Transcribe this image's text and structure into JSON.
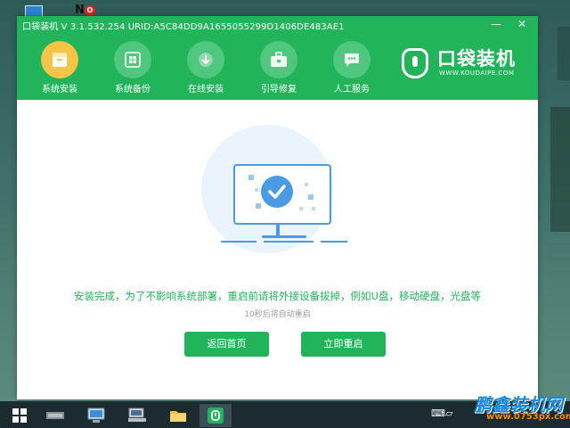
{
  "window": {
    "title": "口袋装机 V 3.1.532.254 URID:A5C84DD9A1655055299D1406DE483AE1",
    "minimize": "—",
    "close": "✕"
  },
  "nav": {
    "items": [
      {
        "label": "系统安装",
        "icon": "box-icon",
        "active": true
      },
      {
        "label": "系统备份",
        "icon": "windows-icon",
        "active": false
      },
      {
        "label": "在线安装",
        "icon": "download-icon",
        "active": false
      },
      {
        "label": "引导修复",
        "icon": "toolbox-icon",
        "active": false
      },
      {
        "label": "人工服务",
        "icon": "chat-icon",
        "active": false
      }
    ]
  },
  "brand": {
    "name": "口袋装机",
    "subtitle": "WWW.KOUDAIPE.COM"
  },
  "content": {
    "main_message": "安装完成，为了不影响系统部署，重启前请将外接设备拔掉，例如U盘，移动硬盘，光盘等",
    "countdown": "10秒后将自动重启",
    "back_button": "返回首页",
    "restart_button": "立即重启"
  },
  "desktop": {
    "np_label": "N"
  },
  "watermark": {
    "name": "鹏鑫装机网",
    "url": "www.0753px.com"
  },
  "colors": {
    "accent": "#22b45a",
    "active_nav": "#f6c446",
    "illustration": "#4a9be4"
  }
}
